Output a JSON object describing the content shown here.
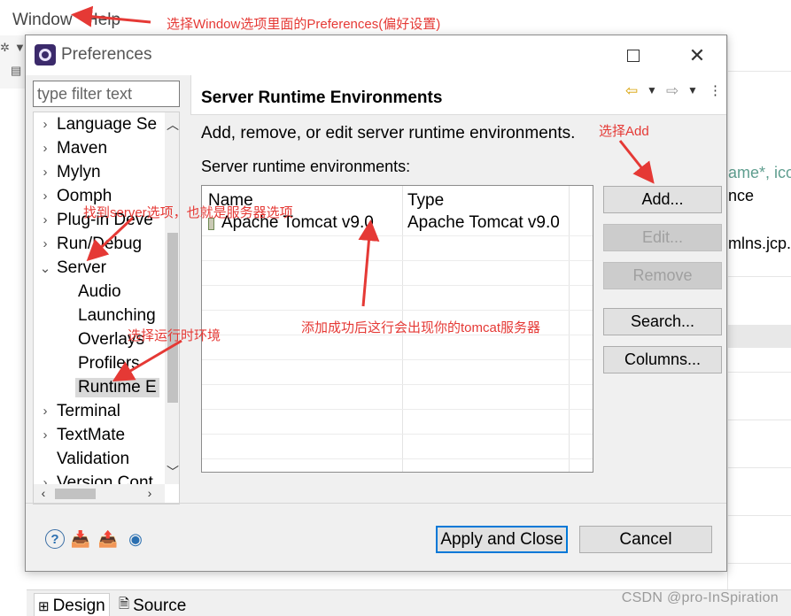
{
  "menubar": {
    "items": [
      "Window",
      "Help"
    ]
  },
  "background": {
    "right_fragments": [
      "ame*, ico",
      "nce",
      "mlns.jcp."
    ],
    "bottom_tabs": [
      {
        "label": "Design",
        "active": true
      },
      {
        "label": "Source",
        "active": false
      }
    ],
    "watermark": "CSDN @pro-InSpiration"
  },
  "dialog": {
    "title": "Preferences",
    "filter_placeholder": "type filter text",
    "tree": [
      {
        "label": "Language Se",
        "expander": "collapsed",
        "indent": 0
      },
      {
        "label": "Maven",
        "expander": "collapsed",
        "indent": 0
      },
      {
        "label": "Mylyn",
        "expander": "collapsed",
        "indent": 0
      },
      {
        "label": "Oomph",
        "expander": "collapsed",
        "indent": 0
      },
      {
        "label": "Plug-in Deve",
        "expander": "collapsed",
        "indent": 0
      },
      {
        "label": "Run/Debug",
        "expander": "collapsed",
        "indent": 0
      },
      {
        "label": "Server",
        "expander": "expanded",
        "indent": 0
      },
      {
        "label": "Audio",
        "expander": "none",
        "indent": 1
      },
      {
        "label": "Launching",
        "expander": "none",
        "indent": 1
      },
      {
        "label": "Overlays",
        "expander": "none",
        "indent": 1
      },
      {
        "label": "Profilers",
        "expander": "none",
        "indent": 1
      },
      {
        "label": "Runtime E",
        "expander": "none",
        "indent": 1,
        "selected": true
      },
      {
        "label": "Terminal",
        "expander": "collapsed",
        "indent": 0
      },
      {
        "label": "TextMate",
        "expander": "collapsed",
        "indent": 0
      },
      {
        "label": "Validation",
        "expander": "none",
        "indent": 0
      },
      {
        "label": "Version Cont",
        "expander": "collapsed",
        "indent": 0
      }
    ],
    "page": {
      "title": "Server Runtime Environments",
      "description": "Add, remove, or edit server runtime environments.",
      "table_label": "Server runtime environments:",
      "columns": [
        "Name",
        "Type"
      ],
      "rows": [
        {
          "name": "Apache Tomcat v9.0",
          "type": "Apache Tomcat v9.0"
        }
      ],
      "buttons": [
        {
          "label": "Add...",
          "enabled": true
        },
        {
          "label": "Edit...",
          "enabled": false
        },
        {
          "label": "Remove",
          "enabled": false
        },
        {
          "label": "Search...",
          "enabled": true
        },
        {
          "label": "Columns...",
          "enabled": true
        }
      ]
    },
    "footer": {
      "apply_close": "Apply and Close",
      "cancel": "Cancel"
    }
  },
  "annotations": {
    "menu": "选择Window选项里面的Preferences(偏好设置)",
    "add": "选择Add",
    "server": "找到server选项，也就是服务器选项",
    "runtime": "选择运行时环境",
    "tomcat": "添加成功后这行会出现你的tomcat服务器",
    "color": "#e53935"
  },
  "colors": {
    "accent": "#0078d7",
    "selection": "#d9d9d9",
    "dialog_bg": "#f0f0f0",
    "annotation": "#e53935"
  }
}
